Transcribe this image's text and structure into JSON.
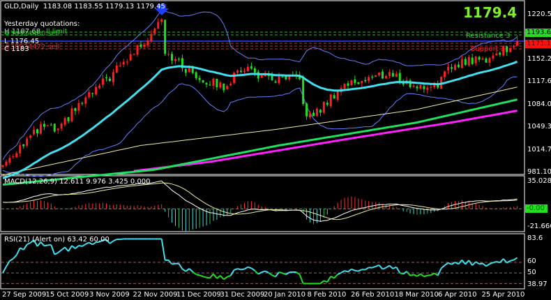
{
  "header": {
    "symbol": "GLD,Daily",
    "ohlc": "1183.08 1183.55 1179.13 1179.45"
  },
  "last_price_big": "1179.4",
  "yesterday": {
    "title": "Yesterday quotations:",
    "high": "H 1187.68",
    "order1": "#38924480 sell",
    "limit": "ll limit",
    "low": "L 1176.45",
    "order2": "#38924472 sell",
    "close": "C 1183"
  },
  "levels": {
    "resistance": "Resistance 3",
    "support": "Support 3"
  },
  "price_axis": {
    "ticks": [
      "1220.50",
      "1152.25",
      "1117.60",
      "1084.00",
      "1049.35",
      "1014.70",
      "981.10"
    ],
    "box_green": "1193.61",
    "box_red": "1171.15"
  },
  "macd": {
    "label": "MACD(12,26,9) 12.611 9.976 3.425 0.000",
    "max": "35.028",
    "zero": "-0.00",
    "min": "-21.666"
  },
  "rsi": {
    "label": "RSI(21) (Alert on) 63.42 60.00",
    "max": "83.6",
    "l60": "60",
    "l50": "50",
    "min": "38.97"
  },
  "dates": [
    "27 Sep 2009",
    "15 Oct 2009",
    "3 Nov 2009",
    "22 Nov 2009",
    "11 Dec 2009",
    "31 Dec 2009",
    "20 Jan 2010",
    "8 Feb 2010",
    "26 Feb 2010",
    "18 Mar 2010",
    "6 Apr 2010",
    "25 Apr 2010"
  ],
  "colors": {
    "bull": "#ff2020",
    "bear": "#20e020",
    "ma_fast": "#40e0f0",
    "ma_mid": "#f0f0a0",
    "ma_slow": "#20e060",
    "ma_long": "#ff20ff",
    "bands": "#6080ff",
    "arrow": "#2040ff"
  },
  "chart_data": {
    "type": "line",
    "title": "GLD,Daily",
    "bars": 150,
    "ylim": [
      981.1,
      1220.5
    ],
    "close_anchors": [
      [
        0,
        990
      ],
      [
        5,
        1020
      ],
      [
        12,
        1050
      ],
      [
        16,
        1040
      ],
      [
        20,
        1070
      ],
      [
        26,
        1100
      ],
      [
        34,
        1140
      ],
      [
        42,
        1185
      ],
      [
        46,
        1218
      ],
      [
        47,
        1165
      ],
      [
        52,
        1140
      ],
      [
        58,
        1120
      ],
      [
        64,
        1110
      ],
      [
        70,
        1140
      ],
      [
        75,
        1125
      ],
      [
        78,
        1120
      ],
      [
        86,
        1120
      ],
      [
        88,
        1060
      ],
      [
        92,
        1075
      ],
      [
        98,
        1110
      ],
      [
        104,
        1120
      ],
      [
        112,
        1130
      ],
      [
        117,
        1115
      ],
      [
        121,
        1108
      ],
      [
        126,
        1115
      ],
      [
        131,
        1145
      ],
      [
        135,
        1150
      ],
      [
        139,
        1150
      ],
      [
        143,
        1160
      ],
      [
        147,
        1172
      ],
      [
        149,
        1179.45
      ]
    ],
    "ma_mid_anchors": [
      [
        0,
        975
      ],
      [
        40,
        1020
      ],
      [
        80,
        1045
      ],
      [
        120,
        1075
      ],
      [
        149,
        1109
      ]
    ],
    "ma_slow_anchors": [
      [
        0,
        960
      ],
      [
        44,
        983
      ],
      [
        80,
        1020
      ],
      [
        120,
        1055
      ],
      [
        149,
        1090
      ]
    ],
    "ma_long_anchors": [
      [
        38,
        981
      ],
      [
        60,
        995
      ],
      [
        100,
        1030
      ],
      [
        130,
        1055
      ],
      [
        149,
        1073
      ]
    ],
    "macd_ylim": [
      -21.666,
      35.028
    ],
    "rsi_ylim": [
      38.97,
      83.6
    ],
    "rsi_levels": [
      60,
      50,
      40
    ]
  }
}
